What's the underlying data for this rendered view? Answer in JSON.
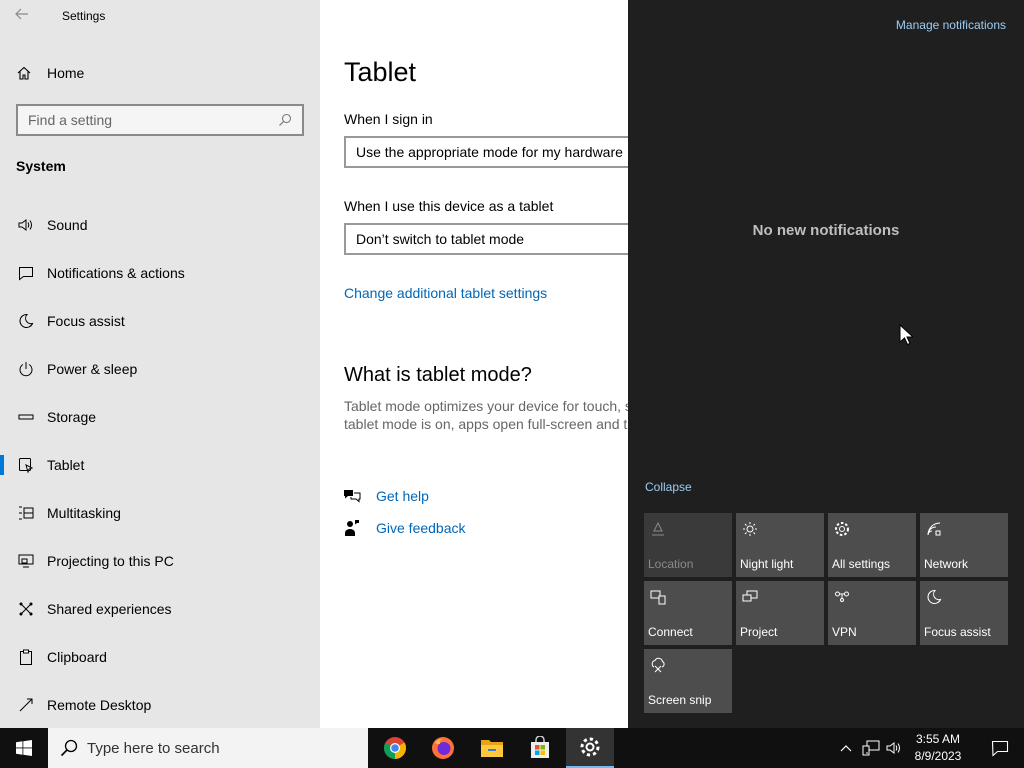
{
  "window": {
    "title": "Settings"
  },
  "sidebar": {
    "home_label": "Home",
    "search_placeholder": "Find a setting",
    "group_label": "System",
    "items": [
      {
        "label": "Sound",
        "icon": "speaker-icon"
      },
      {
        "label": "Notifications & actions",
        "icon": "notification-icon"
      },
      {
        "label": "Focus assist",
        "icon": "moon-icon"
      },
      {
        "label": "Power & sleep",
        "icon": "power-icon"
      },
      {
        "label": "Storage",
        "icon": "storage-icon"
      },
      {
        "label": "Tablet",
        "icon": "tablet-icon",
        "active": true
      },
      {
        "label": "Multitasking",
        "icon": "multitasking-icon"
      },
      {
        "label": "Projecting to this PC",
        "icon": "projecting-icon"
      },
      {
        "label": "Shared experiences",
        "icon": "shared-icon"
      },
      {
        "label": "Clipboard",
        "icon": "clipboard-icon"
      },
      {
        "label": "Remote Desktop",
        "icon": "remote-desktop-icon"
      }
    ]
  },
  "main": {
    "title": "Tablet",
    "sign_in_label": "When I sign in",
    "sign_in_value": "Use the appropriate mode for my hardware",
    "tablet_label": "When I use this device as a tablet",
    "tablet_value": "Don’t switch to tablet mode",
    "additional_link": "Change additional tablet settings",
    "section_title": "What is tablet mode?",
    "desc_line1": "Tablet mode optimizes your device for touch, s",
    "desc_line2": "tablet mode is on, apps open full-screen and t",
    "help_link": "Get help",
    "feedback_link": "Give feedback"
  },
  "action_center": {
    "manage_link": "Manage notifications",
    "empty_text": "No new notifications",
    "collapse_link": "Collapse",
    "tiles": [
      {
        "label": "Location",
        "icon": "location-icon",
        "enabled": false
      },
      {
        "label": "Night light",
        "icon": "brightness-icon",
        "enabled": true
      },
      {
        "label": "All settings",
        "icon": "gear-icon",
        "enabled": true
      },
      {
        "label": "Network",
        "icon": "network-icon",
        "enabled": true
      },
      {
        "label": "Connect",
        "icon": "connect-icon",
        "enabled": true
      },
      {
        "label": "Project",
        "icon": "project-icon",
        "enabled": true
      },
      {
        "label": "VPN",
        "icon": "vpn-icon",
        "enabled": true
      },
      {
        "label": "Focus assist",
        "icon": "moon-icon",
        "enabled": true
      },
      {
        "label": "Screen snip",
        "icon": "screen-snip-icon",
        "enabled": true
      }
    ]
  },
  "taskbar": {
    "search_placeholder": "Type here to search",
    "apps": [
      {
        "name": "chrome-icon"
      },
      {
        "name": "firefox-icon"
      },
      {
        "name": "file-explorer-icon"
      },
      {
        "name": "store-icon"
      },
      {
        "name": "settings-app-icon",
        "running": true
      }
    ],
    "time": "3:55 AM",
    "date": "8/9/2023"
  },
  "colors": {
    "accent": "#0078d7",
    "link": "#0067b8",
    "action_center_bg": "#1f1f1f",
    "tile_bg": "#4d4d4d",
    "taskbar_bg": "#101010"
  }
}
